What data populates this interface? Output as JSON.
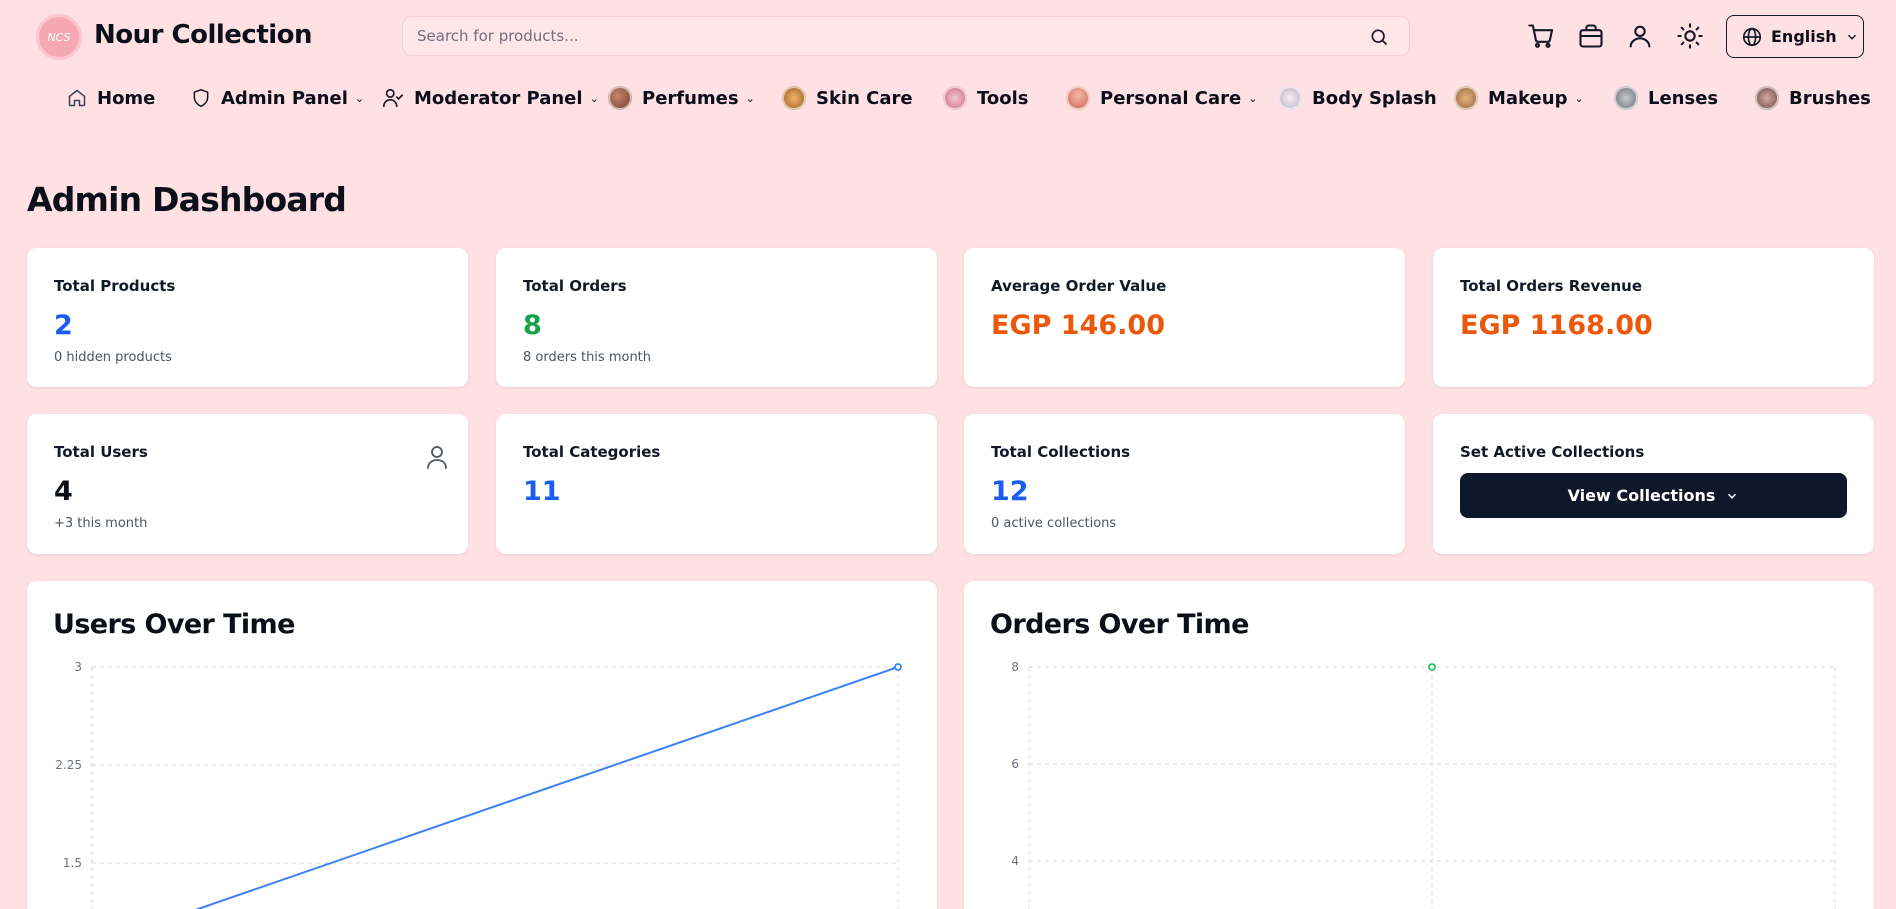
{
  "header": {
    "logo_text": "NCS",
    "brand": "Nour Collection",
    "search_placeholder": "Search for products...",
    "language": "English",
    "icons": [
      "search-icon",
      "cart-icon",
      "bag-icon",
      "user-icon",
      "sun-icon",
      "globe-icon",
      "chevron-down-icon"
    ]
  },
  "nav": {
    "items": [
      {
        "label": "Home",
        "icon": "home-icon"
      },
      {
        "label": "Admin Panel",
        "icon": "shield-icon",
        "dropdown": true
      },
      {
        "label": "Moderator Panel",
        "icon": "user-check-icon",
        "dropdown": true
      },
      {
        "label": "Perfumes",
        "dropdown": true
      },
      {
        "label": "Skin Care"
      },
      {
        "label": "Tools"
      },
      {
        "label": "Personal Care",
        "dropdown": true
      },
      {
        "label": "Body Splash"
      },
      {
        "label": "Makeup",
        "dropdown": true
      },
      {
        "label": "Lenses"
      },
      {
        "label": "Brushes"
      }
    ]
  },
  "page": {
    "title": "Admin Dashboard"
  },
  "stats": {
    "total_products": {
      "label": "Total Products",
      "value": "2",
      "sub": "0 hidden products"
    },
    "total_orders": {
      "label": "Total Orders",
      "value": "8",
      "sub": "8 orders this month"
    },
    "avg_order": {
      "label": "Average Order Value",
      "value": "EGP 146.00"
    },
    "revenue": {
      "label": "Total Orders Revenue",
      "value": "EGP 1168.00"
    },
    "total_users": {
      "label": "Total Users",
      "value": "4",
      "sub": "+3 this month"
    },
    "total_categories": {
      "label": "Total Categories",
      "value": "11"
    },
    "total_collections": {
      "label": "Total Collections",
      "value": "12",
      "sub": "0 active collections"
    },
    "active_collections": {
      "label": "Set Active Collections",
      "button": "View Collections"
    }
  },
  "colors": {
    "accent_blue": "#1d5cf0",
    "accent_green": "#16a34a",
    "accent_orange": "#ea580c",
    "users_line": "#3b82f6",
    "orders_point": "#22c55e",
    "background": "#ffe1e3"
  },
  "chart_data": [
    {
      "type": "line",
      "title": "Users Over Time",
      "yticks": [
        "3",
        "2.25",
        "1.5"
      ],
      "ylim": [
        0,
        3
      ],
      "grid": true,
      "series": [
        {
          "x": [
            0,
            1
          ],
          "y": [
            1,
            3
          ]
        }
      ]
    },
    {
      "type": "line",
      "title": "Orders Over Time",
      "yticks": [
        "8",
        "6",
        "4"
      ],
      "ylim": [
        0,
        8
      ],
      "grid": true,
      "series": [
        {
          "x": [
            0
          ],
          "y": [
            8
          ]
        }
      ]
    }
  ]
}
